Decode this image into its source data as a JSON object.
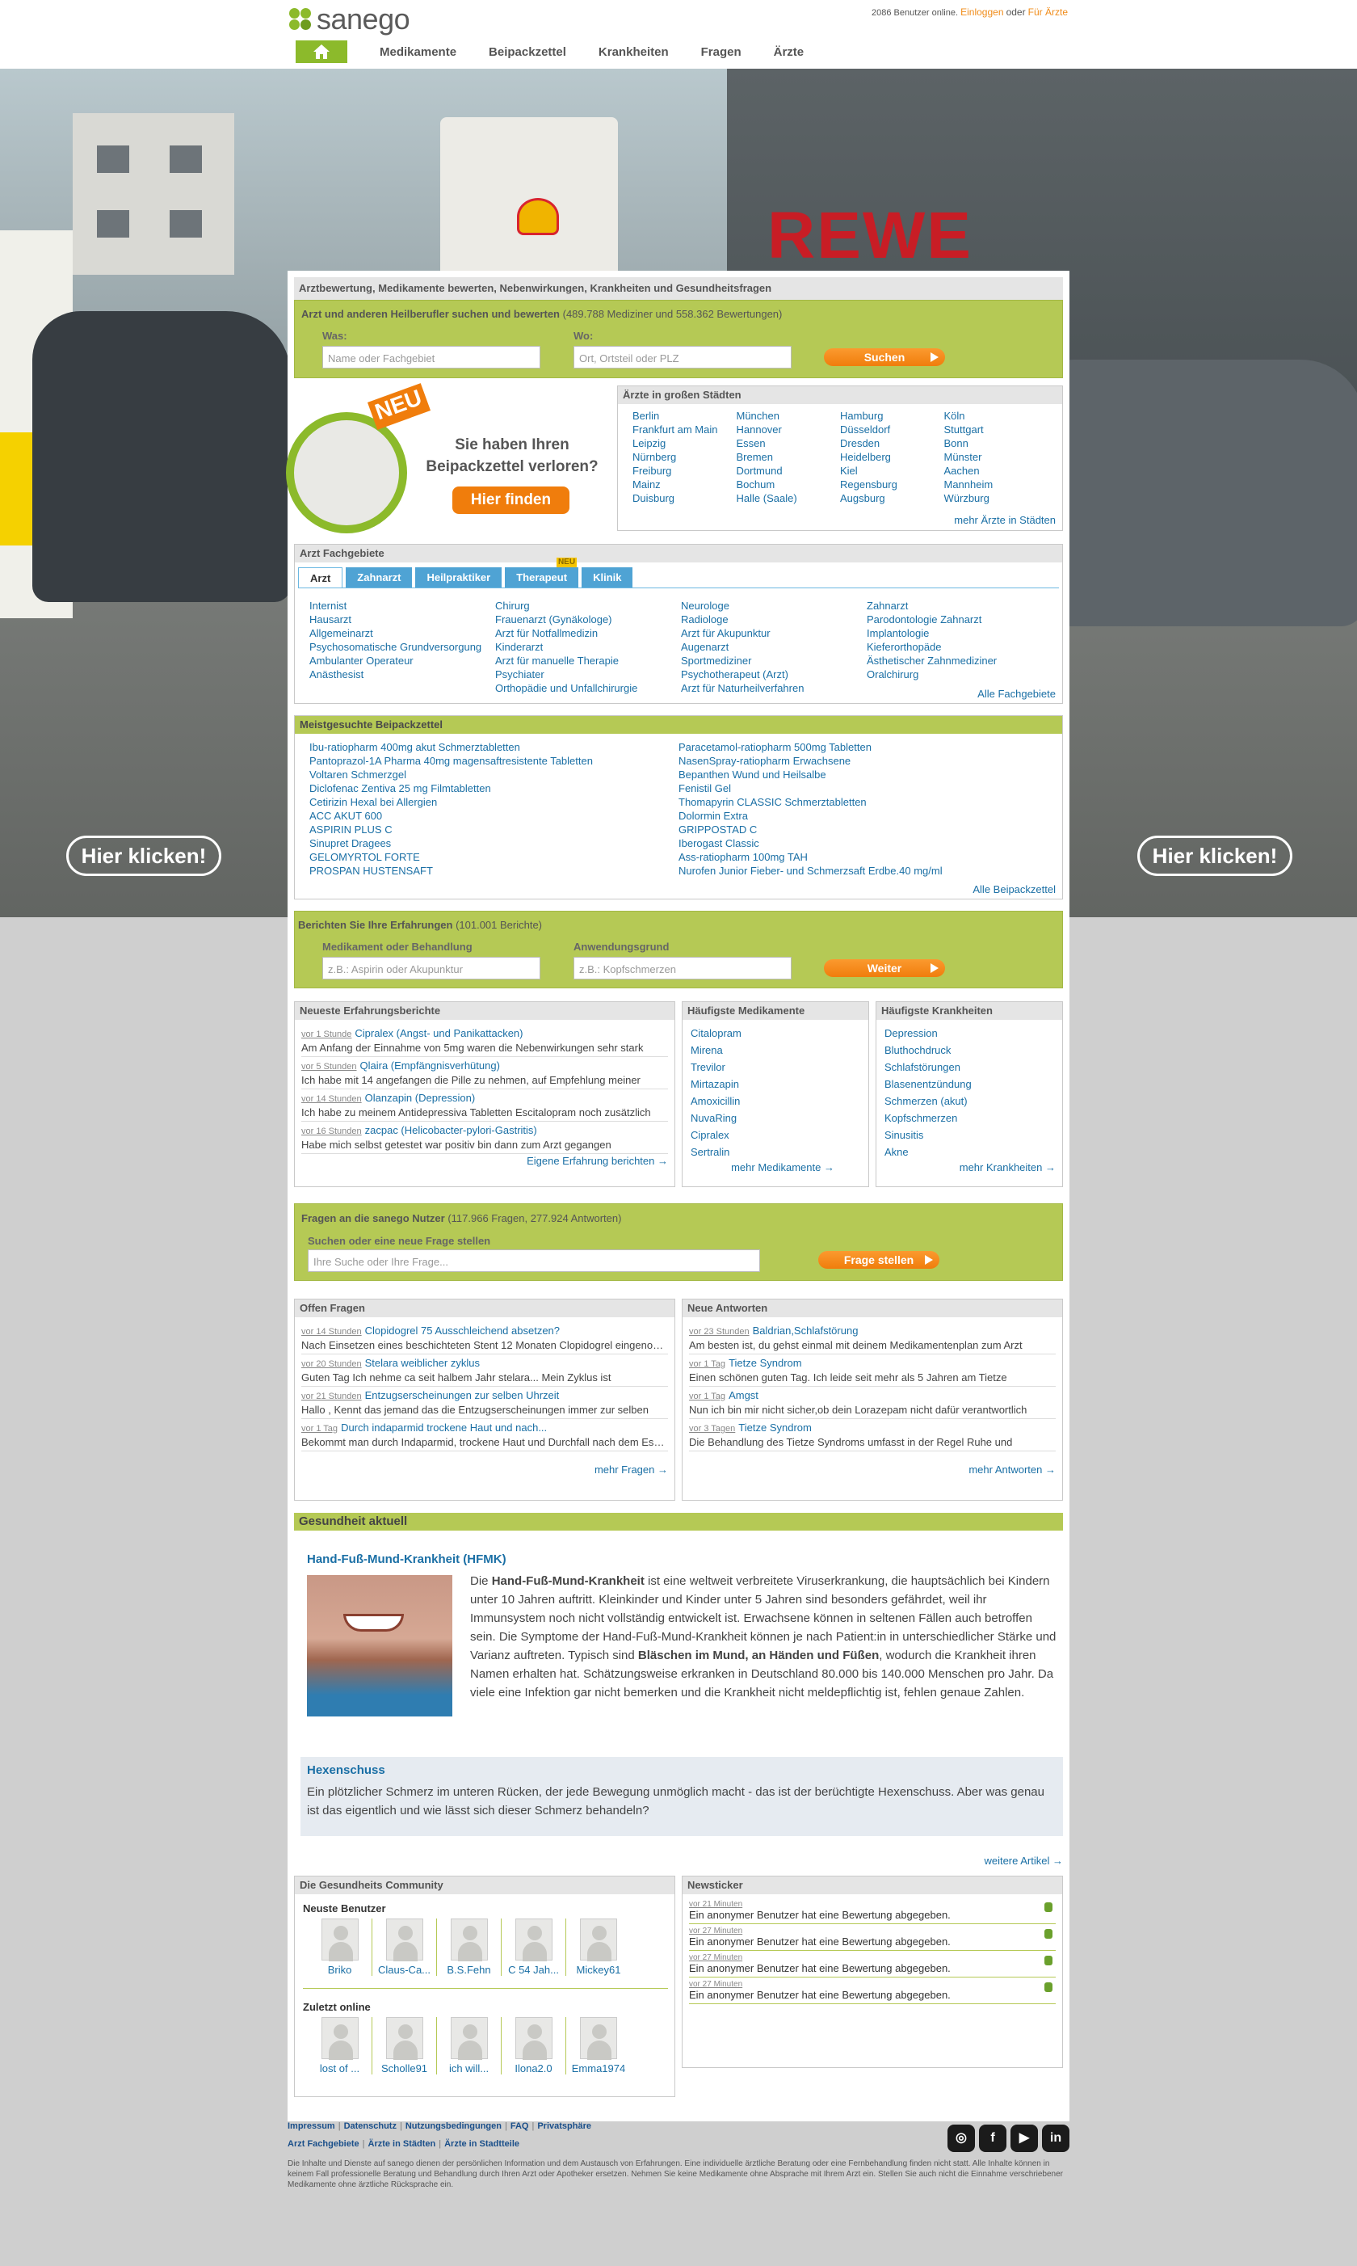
{
  "header": {
    "logo": "sanego",
    "users_online": "2086 Benutzer online.",
    "login": "Einloggen",
    "or": "oder",
    "for_doctors": "Für Ärzte",
    "nav": [
      "Medikamente",
      "Beipackzettel",
      "Krankheiten",
      "Fragen",
      "Ärzte"
    ]
  },
  "hero": {
    "left_button": "Hier klicken!",
    "right_button": "Hier klicken!",
    "sign": "REWE"
  },
  "main": {
    "tagline": "Arztbewertung, Medikamente bewerten, Nebenwirkungen, Krankheiten und Gesundheitsfragen",
    "search": {
      "title": "Arzt und anderen Heilberufler suchen und bewerten",
      "count": "(489.788 Mediziner und 558.362 Bewertungen)",
      "was_label": "Was:",
      "was_placeholder": "Name oder Fachgebiet",
      "wo_label": "Wo:",
      "wo_placeholder": "Ort, Ortsteil oder PLZ",
      "button": "Suchen"
    },
    "promo": {
      "badge": "NEU",
      "text1": "Sie haben Ihren",
      "text2": "Beipackzettel verloren?",
      "button": "Hier finden"
    },
    "cities": {
      "title": "Ärzte in großen Städten",
      "items": [
        "Berlin",
        "München",
        "Hamburg",
        "Köln",
        "Frankfurt am Main",
        "Hannover",
        "Düsseldorf",
        "Stuttgart",
        "Leipzig",
        "Essen",
        "Dresden",
        "Bonn",
        "Nürnberg",
        "Bremen",
        "Heidelberg",
        "Münster",
        "Freiburg",
        "Dortmund",
        "Kiel",
        "Aachen",
        "Mainz",
        "Bochum",
        "Regensburg",
        "Mannheim",
        "Duisburg",
        "Halle (Saale)",
        "Augsburg",
        "Würzburg"
      ],
      "more": "mehr Ärzte in Städten"
    },
    "fach": {
      "title": "Arzt Fachgebiete",
      "tabs": [
        "Arzt",
        "Zahnarzt",
        "Heilpraktiker",
        "Therapeut",
        "Klinik"
      ],
      "tab_badge": "NEU",
      "cols": [
        [
          "Internist",
          "Hausarzt",
          "Allgemeinarzt",
          "Psychosomatische Grundversorgung",
          "Ambulanter Operateur",
          "Anästhesist"
        ],
        [
          "Chirurg",
          "Frauenarzt (Gynäkologe)",
          "Arzt für Notfallmedizin",
          "Kinderarzt",
          "Arzt für manuelle Therapie",
          "Psychiater",
          "Orthopädie und Unfallchirurgie"
        ],
        [
          "Neurologe",
          "Radiologe",
          "Arzt für Akupunktur",
          "Augenarzt",
          "Sportmediziner",
          "Psychotherapeut (Arzt)",
          "Arzt für Naturheilverfahren"
        ],
        [
          "Zahnarzt",
          "Parodontologie Zahnarzt",
          "Implantologie",
          "Kieferorthopäde",
          "Ästhetischer Zahnmediziner",
          "Oralchirurg"
        ]
      ],
      "more": "Alle Fachgebiete"
    },
    "beipack": {
      "title": "Meistgesuchte Beipackzettel",
      "left": [
        "Ibu-ratiopharm 400mg akut Schmerztabletten",
        "Pantoprazol-1A Pharma 40mg magensaftresistente Tabletten",
        "Voltaren Schmerzgel",
        "Diclofenac Zentiva 25 mg Filmtabletten",
        "Cetirizin Hexal bei Allergien",
        "ACC AKUT 600",
        "ASPIRIN PLUS C",
        "Sinupret Dragees",
        "GELOMYRTOL FORTE",
        "PROSPAN HUSTENSAFT"
      ],
      "right": [
        "Paracetamol-ratiopharm 500mg Tabletten",
        "NasenSpray-ratiopharm Erwachsene",
        "Bepanthen Wund und Heilsalbe",
        "Fenistil Gel",
        "Thomapyrin CLASSIC Schmerztabletten",
        "Dolormin Extra",
        "GRIPPOSTAD C",
        "Iberogast Classic",
        "Ass-ratiopharm 100mg TAH",
        "Nurofen Junior Fieber- und Schmerzsaft Erdbe.40 mg/ml"
      ],
      "more": "Alle Beipackzettel"
    },
    "report": {
      "title": "Berichten Sie Ihre Erfahrungen",
      "count": "(101.001 Berichte)",
      "med_label": "Medikament oder Behandlung",
      "med_placeholder": "z.B.: Aspirin oder Akupunktur",
      "reason_label": "Anwendungsgrund",
      "reason_placeholder": "z.B.: Kopfschmerzen",
      "button": "Weiter"
    },
    "reports": {
      "title": "Neueste Erfahrungsberichte",
      "items": [
        {
          "ago": "vor 1 Stunde",
          "link": "Cipralex (Angst- und Panikattacken)",
          "text": "Am Anfang der Einnahme von 5mg waren die Nebenwirkungen sehr stark"
        },
        {
          "ago": "vor 5 Stunden",
          "link": "Qlaira (Empfängnisverhütung)",
          "text": "Ich habe mit 14 angefangen die Pille zu nehmen, auf Empfehlung meiner"
        },
        {
          "ago": "vor 14 Stunden",
          "link": "Olanzapin (Depression)",
          "text": "Ich habe zu meinem Antidepressiva Tabletten Escitalopram noch zusätzlich"
        },
        {
          "ago": "vor 16 Stunden",
          "link": "zacpac (Helicobacter-pylori-Gastritis)",
          "text": "Habe mich selbst getestet war positiv bin dann zum Arzt gegangen"
        }
      ],
      "more": "Eigene Erfahrung berichten"
    },
    "meds": {
      "title": "Häufigste Medikamente",
      "items": [
        "Citalopram",
        "Mirena",
        "Trevilor",
        "Mirtazapin",
        "Amoxicillin",
        "NuvaRing",
        "Cipralex",
        "Sertralin"
      ],
      "more": "mehr Medikamente"
    },
    "diseases": {
      "title": "Häufigste Krankheiten",
      "items": [
        "Depression",
        "Bluthochdruck",
        "Schlafstörungen",
        "Blasenentzündung",
        "Schmerzen (akut)",
        "Kopfschmerzen",
        "Sinusitis",
        "Akne"
      ],
      "more": "mehr Krankheiten"
    },
    "questions": {
      "title": "Fragen an die sanego Nutzer",
      "count": "(117.966 Fragen, 277.924 Antworten)",
      "label": "Suchen oder eine neue Frage stellen",
      "placeholder": "Ihre Suche oder Ihre Frage...",
      "button": "Frage stellen"
    },
    "open": {
      "title": "Offen Fragen",
      "items": [
        {
          "ago": "vor 14 Stunden",
          "link": "Clopidogrel 75 Ausschleichend absetzen?",
          "text": "Nach Einsetzen eines beschichteten Stent 12 Monaten Clopidogrel eingenommen"
        },
        {
          "ago": "vor 20 Stunden",
          "link": "Stelara weiblicher zyklus",
          "text": "Guten Tag Ich nehme ca seit halbem Jahr stelara... Mein Zyklus ist"
        },
        {
          "ago": "vor 21 Stunden",
          "link": "Entzugserscheinungen zur selben Uhrzeit",
          "text": "Hallo , Kennt das jemand das die Entzugserscheinungen immer zur selben"
        },
        {
          "ago": "vor 1 Tag",
          "link": "Durch indaparmid trockene Haut und nach...",
          "text": "Bekommt man durch Indaparmid, trockene Haut und Durchfall nach dem Essen"
        }
      ],
      "more": "mehr Fragen"
    },
    "answers": {
      "title": "Neue Antworten",
      "items": [
        {
          "ago": "vor 23 Stunden",
          "link": "Baldrian,Schlafstörung",
          "text": "Am besten ist, du gehst einmal mit deinem Medikamentenplan zum Arzt"
        },
        {
          "ago": "vor 1 Tag",
          "link": "Tietze Syndrom",
          "text": "Einen schönen guten Tag. Ich leide seit mehr als 5 Jahren am Tietze"
        },
        {
          "ago": "vor 1 Tag",
          "link": "Amgst",
          "text": "Nun ich bin mir nicht sicher,ob dein Lorazepam nicht dafür verantwortlich"
        },
        {
          "ago": "vor 3 Tagen",
          "link": "Tietze Syndrom",
          "text": "Die Behandlung des Tietze Syndroms umfasst in der Regel Ruhe und"
        }
      ],
      "more": "mehr Antworten"
    },
    "health": {
      "title": "Gesundheit aktuell",
      "a1_title": "Hand-Fuß-Mund-Krankheit (HFMK)",
      "a1_p1": "Die ",
      "a1_b1": "Hand-Fuß-Mund-Krankheit",
      "a1_p2": " ist eine weltweit verbreitete Viruserkrankung, die hauptsächlich bei Kindern unter 10 Jahren auftritt. Kleinkinder und Kinder unter 5 Jahren sind besonders gefährdet, weil ihr Immunsystem noch nicht vollständig entwickelt ist. Erwachsene können in seltenen Fällen auch betroffen sein. Die Symptome der Hand-Fuß-Mund-Krankheit können je nach Patient:in in unterschiedlicher Stärke und Varianz auftreten. Typisch sind ",
      "a1_b2": "Bläschen im Mund, an Händen und Füßen",
      "a1_p3": ", wodurch die Krankheit ihren Namen erhalten hat. Schätzungsweise erkranken in Deutschland 80.000 bis 140.000 Menschen pro Jahr. Da viele eine Infektion gar nicht bemerken und die Krankheit nicht meldepflichtig ist, fehlen genaue Zahlen.",
      "a2_title": "Hexenschuss",
      "a2_text": "Ein plötzlicher Schmerz im unteren Rücken, der jede Bewegung unmöglich macht - das ist der berüchtigte Hexenschuss. Aber was genau ist das eigentlich und wie lässt sich dieser Schmerz behandeln?",
      "more": "weitere Artikel"
    },
    "community": {
      "title": "Die Gesundheits Community",
      "newest_label": "Neuste Benutzer",
      "newest": [
        "Briko",
        "Claus-Ca...",
        "B.S.Fehn",
        "C 54 Jah...",
        "Mickey61"
      ],
      "online_label": "Zuletzt online",
      "online": [
        "lost of ...",
        "Scholle91",
        "ich will...",
        "Ilona2.0",
        "Emma1974"
      ]
    },
    "ticker": {
      "title": "Newsticker",
      "items": [
        {
          "ago": "vor 21 Minuten",
          "text": "Ein anonymer Benutzer hat eine Bewertung abgegeben."
        },
        {
          "ago": "vor 27 Minuten",
          "text": "Ein anonymer Benutzer hat eine Bewertung abgegeben."
        },
        {
          "ago": "vor 27 Minuten",
          "text": "Ein anonymer Benutzer hat eine Bewertung abgegeben."
        },
        {
          "ago": "vor 27 Minuten",
          "text": "Ein anonymer Benutzer hat eine Bewertung abgegeben."
        }
      ]
    }
  },
  "footer": {
    "links1": [
      "Impressum",
      "Datenschutz",
      "Nutzungsbedingungen",
      "FAQ",
      "Privatsphäre"
    ],
    "links2": [
      "Arzt Fachgebiete",
      "Ärzte in Städten",
      "Ärzte in Stadtteile"
    ],
    "disclaimer": "Die Inhalte und Dienste auf sanego dienen der persönlichen Information und dem Austausch von Erfahrungen. Eine individuelle ärztliche Beratung oder eine Fernbehandlung finden nicht statt. Alle Inhalte können in keinem Fall professionelle Beratung und Behandlung durch Ihren Arzt oder Apotheker ersetzen. Nehmen Sie keine Medikamente ohne Absprache mit Ihrem Arzt ein. Stellen Sie auch nicht die Einnahme verschriebener Medikamente ohne ärztliche Rücksprache ein.",
    "social": [
      "instagram-icon",
      "facebook-icon",
      "youtube-icon",
      "linkedin-icon"
    ]
  }
}
